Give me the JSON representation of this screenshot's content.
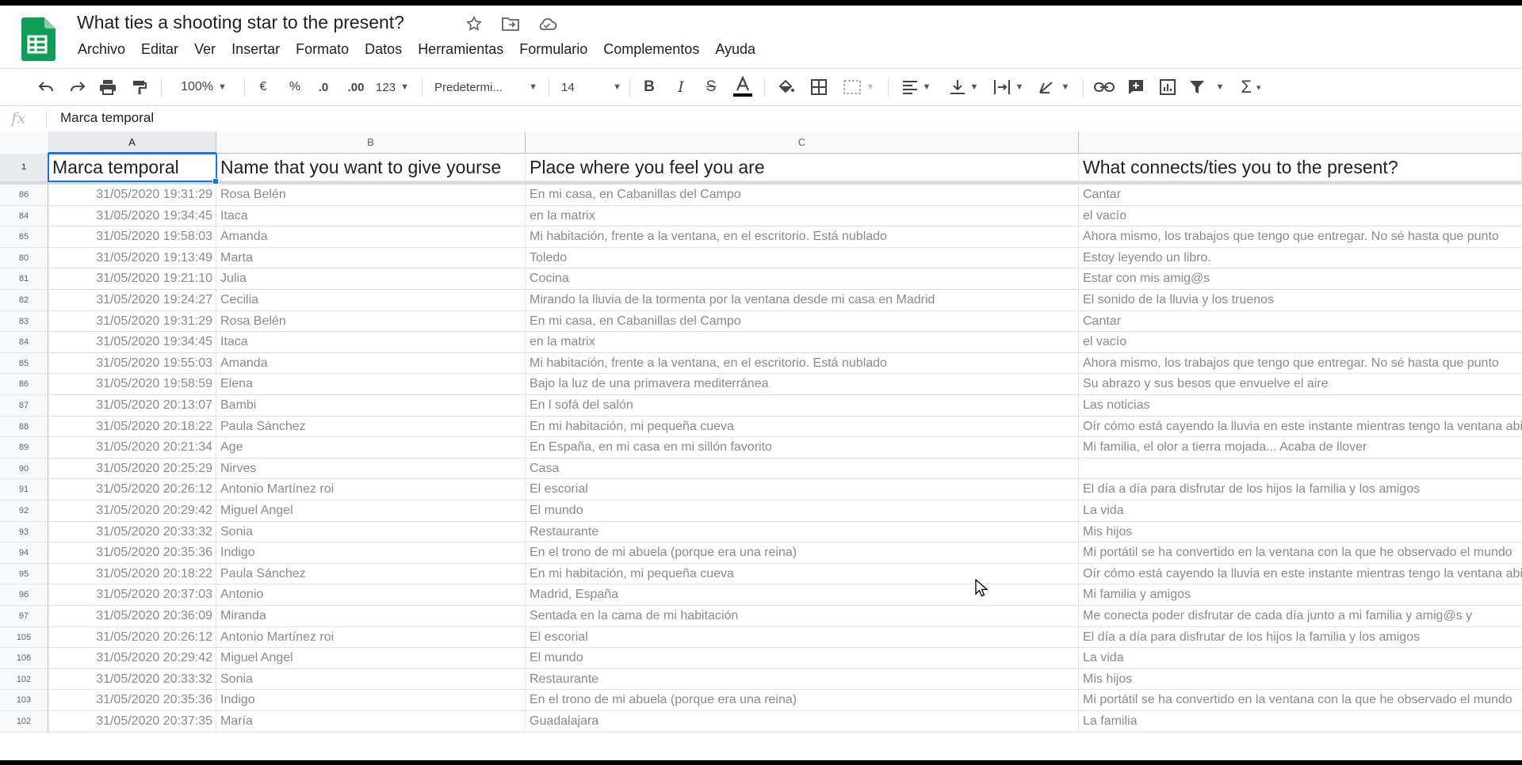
{
  "doc": {
    "title": "What ties a shooting star to the present?"
  },
  "menu": [
    "Archivo",
    "Editar",
    "Ver",
    "Insertar",
    "Formato",
    "Datos",
    "Herramientas",
    "Formulario",
    "Complementos",
    "Ayuda"
  ],
  "toolbar": {
    "zoom": "100%",
    "currency": "€",
    "percent": "%",
    "dec_less": ".0",
    "dec_more": ".00",
    "more_formats": "123",
    "font": "Predetermi...",
    "font_size": "14",
    "icons": [
      "undo-icon",
      "redo-icon",
      "print-icon",
      "paint-format-icon",
      "bold-icon",
      "italic-icon",
      "strikethrough-icon",
      "text-color-icon",
      "fill-color-icon",
      "borders-icon",
      "merge-icon",
      "align-icon",
      "valign-icon",
      "wrap-icon",
      "rotate-icon",
      "link-icon",
      "comment-icon",
      "chart-icon",
      "filter-icon",
      "functions-icon"
    ]
  },
  "formula_bar": {
    "fx": "fx",
    "value": "Marca temporal"
  },
  "columns": [
    "A",
    "B",
    "C"
  ],
  "header_row": {
    "num": "1",
    "a": "Marca temporal",
    "b": "Name that you want to give yourse",
    "c": "Place where you feel you are",
    "d": "What connects/ties you to the present?"
  },
  "rows": [
    {
      "num": "86",
      "a": "31/05/2020 19:31:29",
      "b": "Rosa Belén",
      "c": "En mi casa, en Cabanillas del Campo",
      "d": "Cantar"
    },
    {
      "num": "84",
      "a": "31/05/2020 19:34:45",
      "b": "Itaca",
      "c": "en la matrix",
      "d": "el vacío"
    },
    {
      "num": "85",
      "a": "31/05/2020 19:58:03",
      "b": "Amanda",
      "c": "Mi habitación, frente a la ventana, en el escritorio. Está nublado",
      "d": "Ahora mismo, los trabajos que tengo que entregar. No sé hasta que punto"
    },
    {
      "num": "80",
      "a": "31/05/2020 19:13:49",
      "b": "Marta",
      "c": "Toledo",
      "d": "Estoy leyendo un libro."
    },
    {
      "num": "81",
      "a": "31/05/2020 19:21:10",
      "b": "Julia",
      "c": "Cocina",
      "d": "Estar con mis amig@s"
    },
    {
      "num": "82",
      "a": "31/05/2020 19:24:27",
      "b": "Cecilia",
      "c": "Mirando la lluvia de la tormenta por la ventana desde mi casa en Madrid",
      "d": "El sonido de la lluvia y los truenos"
    },
    {
      "num": "83",
      "a": "31/05/2020 19:31:29",
      "b": "Rosa Belén",
      "c": "En mi casa, en Cabanillas del Campo",
      "d": "Cantar"
    },
    {
      "num": "84",
      "a": "31/05/2020 19:34:45",
      "b": "Itaca",
      "c": "en la matrix",
      "d": "el vacío"
    },
    {
      "num": "85",
      "a": "31/05/2020 19:55:03",
      "b": "Amanda",
      "c": "Mi habitación, frente a la ventana, en el escritorio. Está nublado",
      "d": "Ahora mismo, los trabajos que tengo que entregar. No sé hasta que punto"
    },
    {
      "num": "86",
      "a": "31/05/2020 19:58:59",
      "b": "Elena",
      "c": "Bajo la luz de una primavera mediterránea",
      "d": "Su abrazo y sus besos que envuelve el aire"
    },
    {
      "num": "87",
      "a": "31/05/2020 20:13:07",
      "b": "Bambi",
      "c": "En l sofá del salón",
      "d": "Las noticias"
    },
    {
      "num": "88",
      "a": "31/05/2020 20:18:22",
      "b": "Paula Sánchez",
      "c": "En mi habitación, mi pequeña cueva",
      "d": "Oír cómo está cayendo la lluvia en este instante mientras tengo la ventana abierta"
    },
    {
      "num": "89",
      "a": "31/05/2020 20:21:34",
      "b": "Age",
      "c": "En España, en mi casa en mi sillón favorito",
      "d": "Mi familia, el olor a tierra mojada... Acaba de llover"
    },
    {
      "num": "90",
      "a": "31/05/2020 20:25:29",
      "b": "Nirves",
      "c": "Casa",
      "d": ""
    },
    {
      "num": "91",
      "a": "31/05/2020 20:26:12",
      "b": "Antonio Martínez roi",
      "c": "El escorial",
      "d": "El día a día para disfrutar de los hijos la familia y los amigos"
    },
    {
      "num": "92",
      "a": "31/05/2020 20:29:42",
      "b": "Miguel Angel",
      "c": "El mundo",
      "d": "La vida"
    },
    {
      "num": "93",
      "a": "31/05/2020 20:33:32",
      "b": "Sonia",
      "c": "Restaurante",
      "d": "Mis hijos"
    },
    {
      "num": "94",
      "a": "31/05/2020 20:35:36",
      "b": "Indigo",
      "c": "En el trono de mi abuela (porque era una reina)",
      "d": "Mi portátil se ha convertido en la ventana con la que he observado el mundo"
    },
    {
      "num": "95",
      "a": "31/05/2020 20:18:22",
      "b": "Paula Sánchez",
      "c": "En mi habitación, mi pequeña cueva",
      "d": "Oír cómo está cayendo la lluvia en este instante mientras tengo la ventana abierta"
    },
    {
      "num": "96",
      "a": "31/05/2020 20:37:03",
      "b": "Antonio",
      "c": "Madrid, España",
      "d": "Mi familia y amigos"
    },
    {
      "num": "97",
      "a": "31/05/2020 20:36:09",
      "b": "Miranda",
      "c": "Sentada en la cama de mi habitación",
      "d": "Me conecta poder disfrutar de cada día junto a mi familia y amig@s y"
    },
    {
      "num": "105",
      "a": "31/05/2020 20:26:12",
      "b": "Antonio Martínez roi",
      "c": "El escorial",
      "d": "El día a día para disfrutar de los hijos la familia y los amigos"
    },
    {
      "num": "106",
      "a": "31/05/2020 20:29:42",
      "b": "Miguel Angel",
      "c": "El mundo",
      "d": "La vida"
    },
    {
      "num": "102",
      "a": "31/05/2020 20:33:32",
      "b": "Sonia",
      "c": "Restaurante",
      "d": "Mis hijos"
    },
    {
      "num": "103",
      "a": "31/05/2020 20:35:36",
      "b": "Indigo",
      "c": "En el trono de mi abuela (porque era una reina)",
      "d": "Mi portátil se ha convertido en la ventana con la que he observado el mundo"
    },
    {
      "num": "102",
      "a": "31/05/2020 20:37:35",
      "b": "María",
      "c": "Guadalajara",
      "d": "La familia"
    }
  ],
  "colors": {
    "accent": "#1a73e8",
    "sheets_green": "#0f9d58"
  }
}
